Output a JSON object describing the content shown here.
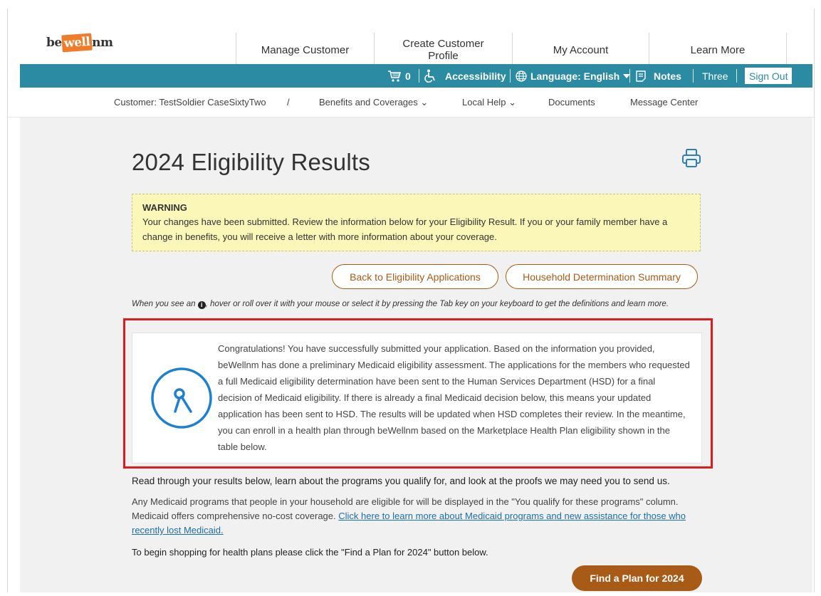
{
  "header": {
    "logo_text": "bewellnm",
    "nav": [
      "Manage Customer",
      "Create Customer Profile",
      "My Account",
      "Learn More"
    ]
  },
  "utility_bar": {
    "cart_count": "0",
    "accessibility": "Accessibility",
    "language": "Language: English",
    "notes": "Notes",
    "user": "Three",
    "sign_out": "Sign Out",
    "color": "#2a8ba3"
  },
  "subnav": {
    "customer": "Customer: TestSoldier CaseSixtyTwo",
    "divider": "/",
    "benefits": "Benefits and Coverages",
    "local_help": "Local Help",
    "documents": "Documents",
    "message_center": "Message Center"
  },
  "page": {
    "title": "2024 Eligibility Results",
    "warning_title": "WARNING",
    "warning_text": "Your changes have been submitted. Review the information below for your Eligibility Result. If you or your family member have a change in benefits, you will receive a letter with more information about your coverage.",
    "btn_back": "Back to Eligibility Applications",
    "btn_household": "Household Determination Summary",
    "hint_pre": "When you see an",
    "hint_post": ", hover or roll over it with your mouse or select it by pressing the Tab key on your keyboard to get the definitions and learn more.",
    "card_text": "Congratulations! You have successfully submitted your application. Based on the information you provided, beWellnm has done a preliminary Medicaid eligibility assessment. The applications for the members who requested a full Medicaid eligibility determination have been sent to the Human Services Department (HSD) for a final decision of Medicaid eligibility. If there is already a final Medicaid decision below, this means your updated application has been sent to HSD. The results will be updated when HSD completes their review. In the meantime, you can enroll in a health plan through beWellnm based on the Marketplace Health Plan eligibility shown in the table below.",
    "read_through": "Read through your results below, learn about the programs you qualify for, and look at the proofs we may need you to send us.",
    "medicaid_text": "Any Medicaid programs that people in your household are eligible for will be displayed in the \"You qualify for these programs\" column. Medicaid offers comprehensive no-cost coverage.",
    "medicaid_link": "Click here to learn more about Medicaid programs and new assistance for those who recently lost Medicaid.",
    "begin_shopping": "To begin shopping for health plans please click the \"Find a Plan for 2024\" button below.",
    "btn_find_plan": "Find a Plan for 2024",
    "accent_color": "#a75b16"
  }
}
